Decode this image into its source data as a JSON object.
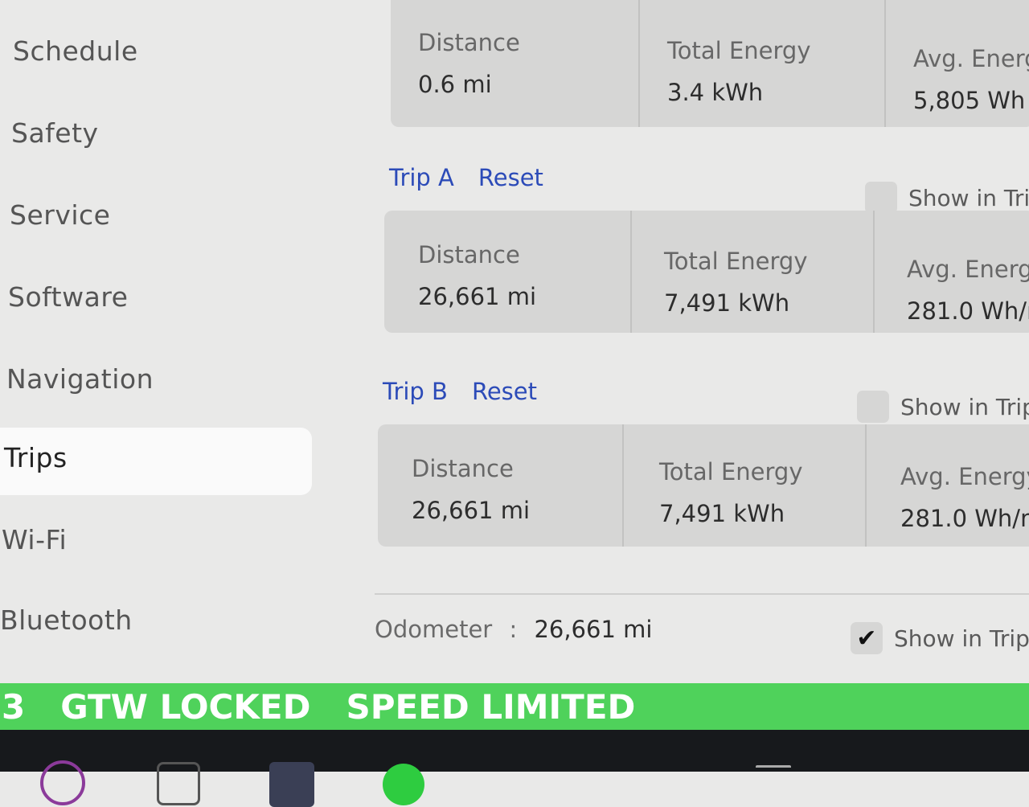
{
  "sidebar": {
    "items": [
      {
        "label": "Schedule"
      },
      {
        "label": "Safety"
      },
      {
        "label": "Service"
      },
      {
        "label": "Software"
      },
      {
        "label": "Navigation"
      },
      {
        "label": "Trips",
        "active": true
      },
      {
        "label": "Wi-Fi"
      },
      {
        "label": "Bluetooth"
      }
    ]
  },
  "since_last_charge": {
    "distance_label": "Distance",
    "distance_value": "0.6 mi",
    "energy_label": "Total Energy",
    "energy_value": "3.4 kWh",
    "avg_label": "Avg. Energ",
    "avg_value": "5,805 Wh"
  },
  "trip_a": {
    "title": "Trip A",
    "reset": "Reset",
    "show_in_trip": "Show in Tri",
    "distance_label": "Distance",
    "distance_value": "26,661 mi",
    "energy_label": "Total Energy",
    "energy_value": "7,491 kWh",
    "avg_label": "Avg. Energ",
    "avg_value": "281.0 Wh/r"
  },
  "trip_b": {
    "title": "Trip B",
    "reset": "Reset",
    "show_in_trip": "Show in Trip",
    "distance_label": "Distance",
    "distance_value": "26,661 mi",
    "energy_label": "Total Energy",
    "energy_value": "7,491 kWh",
    "avg_label": "Avg. Energy",
    "avg_value": "281.0 Wh/m"
  },
  "odometer": {
    "label": "Odometer",
    "separator": ":",
    "value": "26,661 mi",
    "show_in_trip": "Show in Trips",
    "checked": true
  },
  "status_bar": {
    "prefix": "3",
    "gtw": "GTW LOCKED",
    "speed": "SPEED LIMITED"
  },
  "icons": {
    "checkmark": "✔"
  },
  "colors": {
    "accent_blue": "#2c4bb8",
    "status_green": "#4fd25b"
  }
}
